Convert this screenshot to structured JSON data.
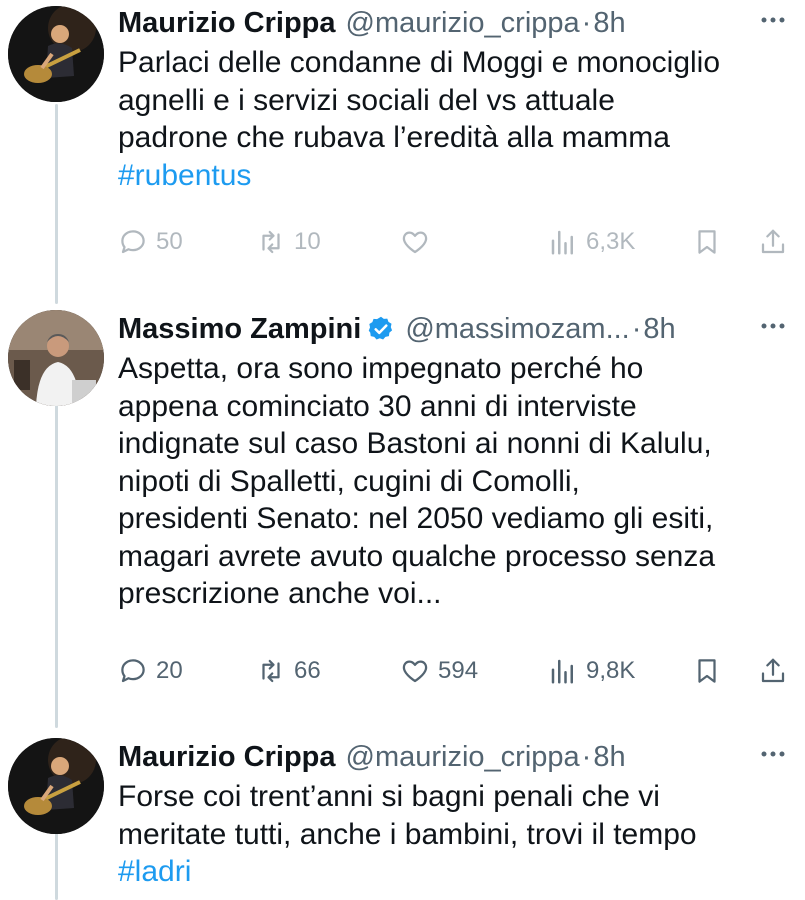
{
  "tweets": [
    {
      "name": "Maurizio Crippa",
      "handle": "@maurizio_crippa",
      "separator": "·",
      "time": "8h",
      "verified": false,
      "lines": [
        "Parlaci delle condanne di Moggi e monociglio",
        "agnelli e i servizi sociali del vs attuale",
        "padrone che rubava l’eredità alla mamma"
      ],
      "hashtag": "#rubentus",
      "replies": "50",
      "retweets": "10",
      "likes": "",
      "views": "6,3K"
    },
    {
      "name": "Massimo Zampini",
      "handle": "@massimozam...",
      "separator": "·",
      "time": "8h",
      "verified": true,
      "lines": [
        "Aspetta, ora sono impegnato perché ho",
        "appena cominciato 30 anni di interviste",
        "indignate sul caso Bastoni ai nonni di Kalulu,",
        "nipoti di Spalletti, cugini di Comolli,",
        "presidenti Senato: nel 2050 vediamo gli esiti,",
        "magari avrete avuto qualche processo senza",
        "prescrizione anche voi..."
      ],
      "replies": "20",
      "retweets": "66",
      "likes": "594",
      "views": "9,8K"
    },
    {
      "name": "Maurizio Crippa",
      "handle": "@maurizio_crippa",
      "separator": "·",
      "time": "8h",
      "verified": false,
      "lines": [
        "Forse coi trent’anni si bagni penali che vi",
        "meritate tutti, anche i bambini, trovi il tempo"
      ],
      "hashtag": "#ladri"
    }
  ],
  "icons": {
    "reply": "reply-icon",
    "retweet": "retweet-icon",
    "like": "heart-icon",
    "views": "views-icon",
    "bookmark": "bookmark-icon",
    "share": "share-icon",
    "more": "more-icon",
    "verified": "verified-badge-icon"
  },
  "colors": {
    "text": "#0f1419",
    "secondary": "#536471",
    "link": "#1d9bf0",
    "verified": "#1d9bf0",
    "thread_line": "#cfd9de"
  }
}
